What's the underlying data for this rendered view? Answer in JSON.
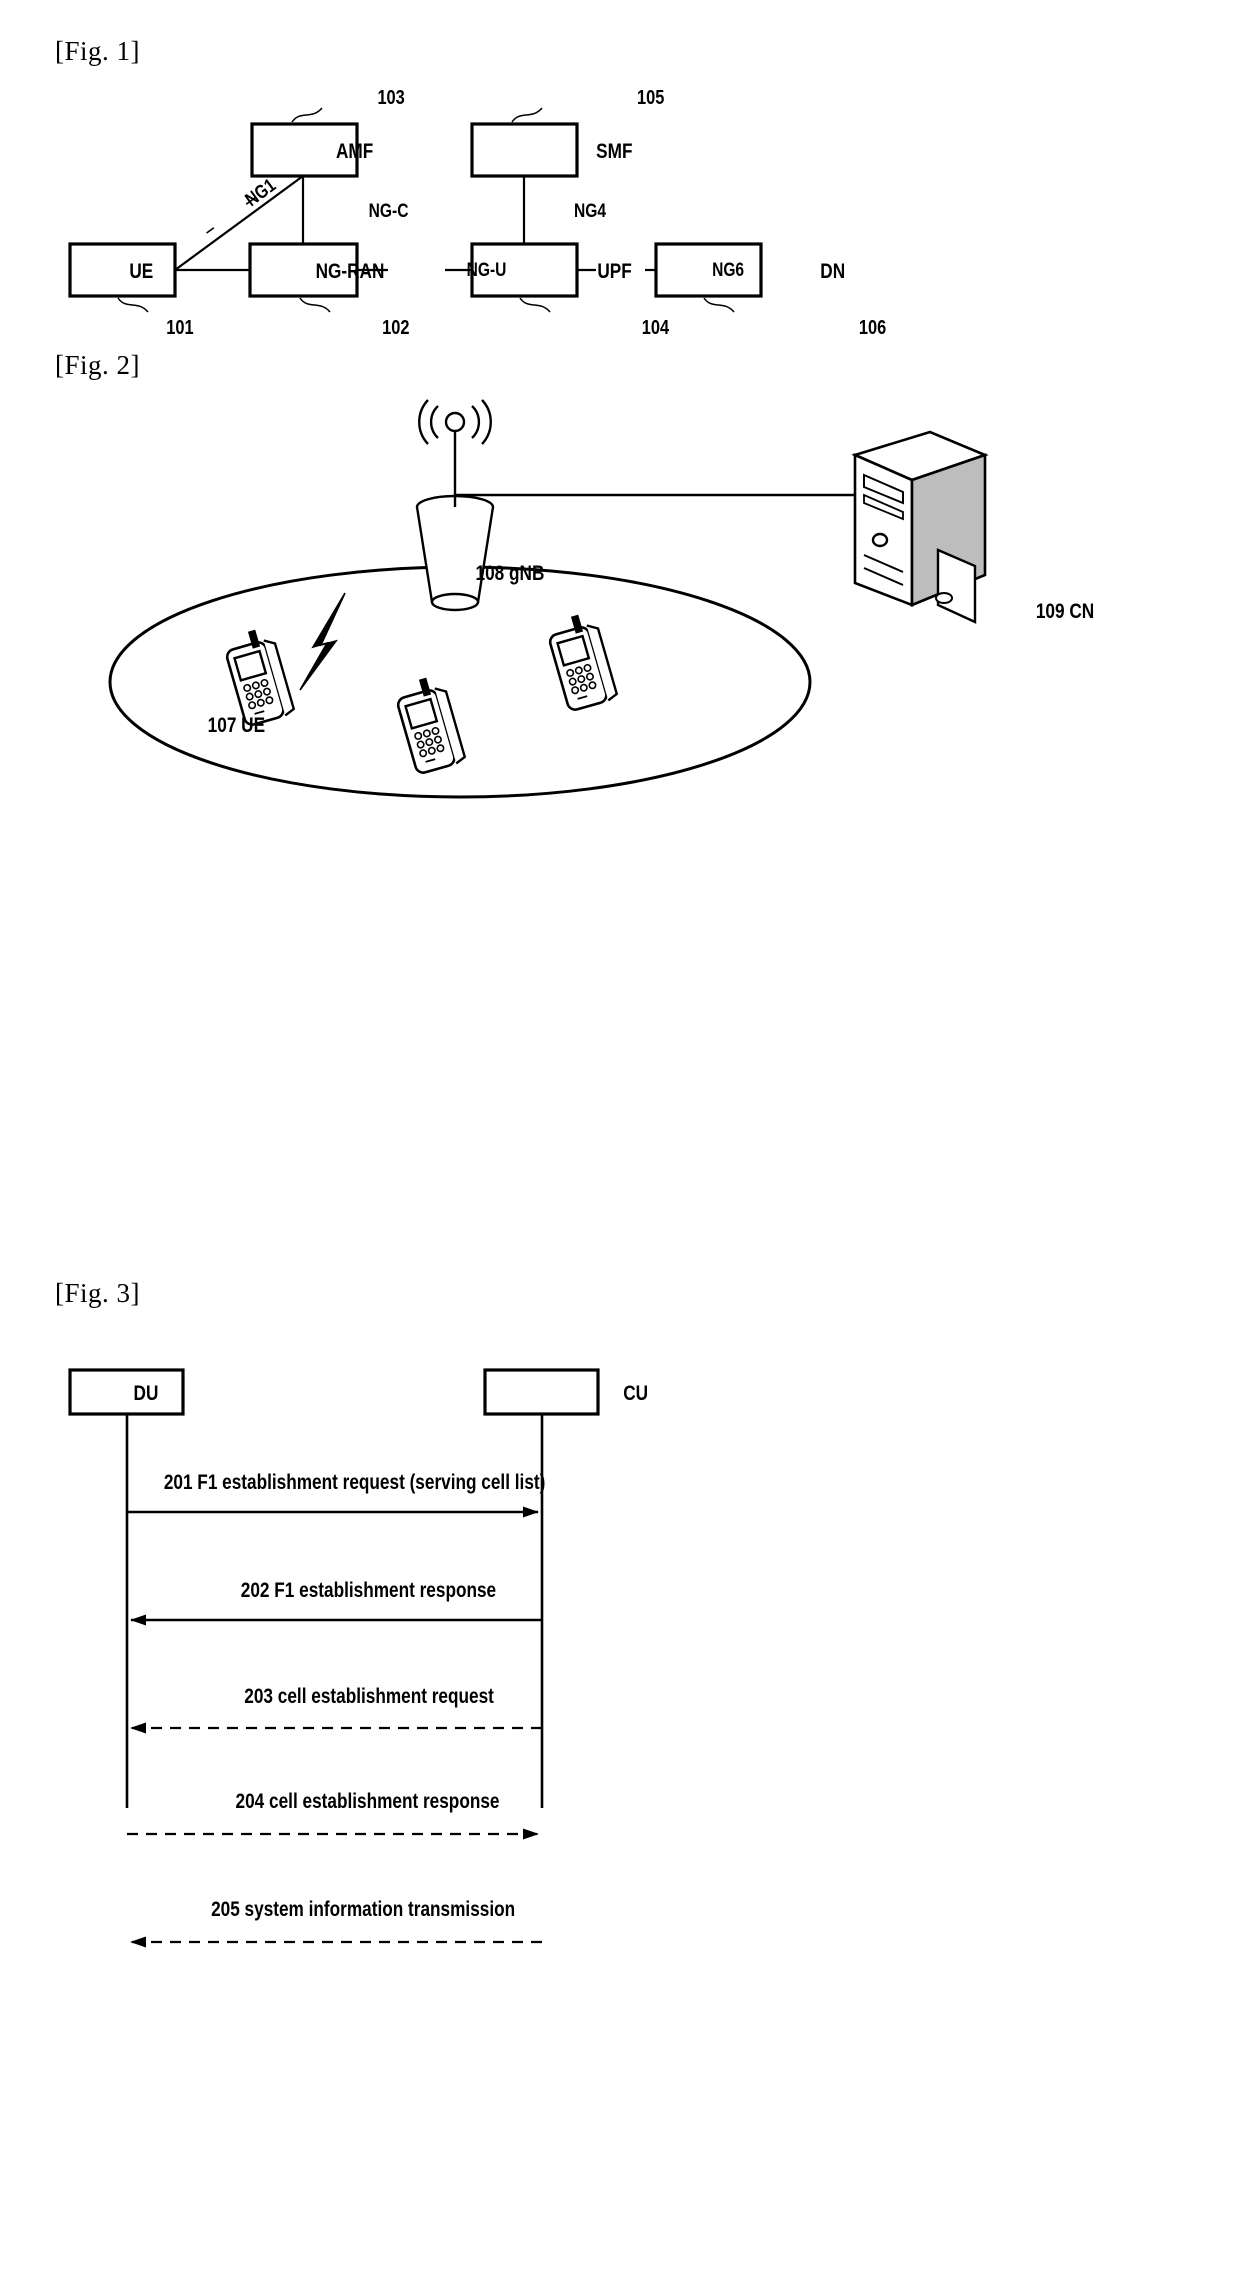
{
  "document": {
    "type": "patent-drawing-sheet",
    "background": "#ffffff",
    "ink": "#000000"
  },
  "figures": [
    {
      "label": "[Fig. 1]",
      "title": "5G system architecture",
      "nodes": [
        {
          "name": "AMF",
          "ref": "103"
        },
        {
          "name": "SMF",
          "ref": "105"
        },
        {
          "name": "UE",
          "ref": "101"
        },
        {
          "name": "NG-RAN",
          "ref": "102"
        },
        {
          "name": "UPF",
          "ref": "104"
        },
        {
          "name": "DN",
          "ref": "106"
        }
      ],
      "interfaces": [
        {
          "name": "NG1",
          "from": "UE",
          "to": "AMF",
          "style": "diagonal"
        },
        {
          "name": "NG-C",
          "from": "NG-RAN",
          "to": "AMF",
          "style": "vertical"
        },
        {
          "name": "NG4",
          "from": "UPF",
          "to": "SMF",
          "style": "vertical"
        },
        {
          "name": "NG-U",
          "from": "NG-RAN",
          "to": "UPF",
          "style": "horizontal"
        },
        {
          "name": "NG6",
          "from": "UPF",
          "to": "DN",
          "style": "horizontal"
        }
      ]
    },
    {
      "label": "[Fig. 2]",
      "title": "Cell coverage with gNB, UEs and core network",
      "items": [
        {
          "icon": "base-station-icon",
          "caption": "108 gNB"
        },
        {
          "icon": "server-tower-icon",
          "caption": "109 CN"
        },
        {
          "icon": "mobile-phone-icon",
          "caption": "107 UE"
        },
        {
          "icon": "mobile-phone-icon",
          "caption": ""
        },
        {
          "icon": "mobile-phone-icon",
          "caption": ""
        }
      ]
    },
    {
      "label": "[Fig. 3]",
      "title": "F1 setup message sequence",
      "lifelines": [
        {
          "name": "DU"
        },
        {
          "name": "CU"
        }
      ],
      "messages": [
        {
          "text": "201 F1 establishment request (serving cell list)",
          "direction": "right",
          "style": "solid"
        },
        {
          "text": "202 F1 establishment response",
          "direction": "left",
          "style": "solid"
        },
        {
          "text": "203 cell establishment request",
          "direction": "left",
          "style": "dashed"
        },
        {
          "text": "204 cell establishment response",
          "direction": "right",
          "style": "dashed"
        },
        {
          "text": "205 system information transmission",
          "direction": "left",
          "style": "dashed"
        }
      ]
    }
  ]
}
